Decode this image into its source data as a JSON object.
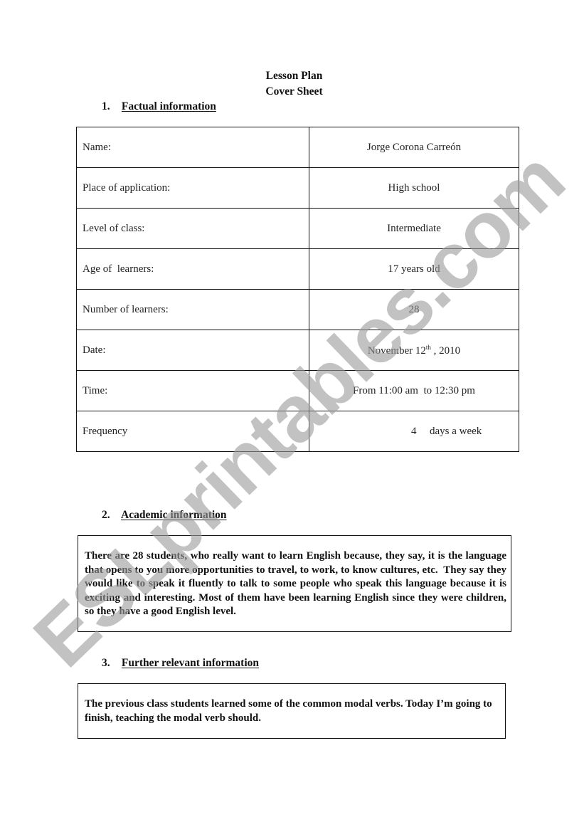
{
  "document": {
    "title_line_1": "Lesson Plan",
    "title_line_2": "Cover Sheet"
  },
  "sections": [
    {
      "number": "1.",
      "heading": "Factual information",
      "rows": [
        {
          "label": "Name:",
          "value": "Jorge Corona Carreón"
        },
        {
          "label": "Place of application:",
          "value": "High school"
        },
        {
          "label": "Level of class:",
          "value": "Intermediate"
        },
        {
          "label": "Age of  learners:",
          "value": "17 years old"
        },
        {
          "label": "Number of learners:",
          "value": "28"
        },
        {
          "label": "Date:",
          "value_prefix": "November 12",
          "value_sup": "th",
          "value_suffix": " , 2010"
        },
        {
          "label": "Time:",
          "value": "From 11:00 am  to 12:30 pm"
        },
        {
          "label": "Frequency",
          "value_number": "4",
          "value_text": "days a week"
        }
      ]
    },
    {
      "number": "2.",
      "heading": "Academic information",
      "body": "There are 28 students, who really want to learn English because, they say, it is the language that opens to you more opportunities to travel, to work, to know cultures, etc.  They say they would like to speak it fluently to talk to some people who speak this language because it is exciting and interesting. Most of them have been learning English since they were children, so they have a good English level."
    },
    {
      "number": "3.",
      "heading": "Further relevant information",
      "body": "The previous class students learned some of the common modal verbs. Today I’m going to finish, teaching the modal verb should."
    }
  ],
  "watermark": {
    "text": "ESLprintables.com",
    "color": "#9a9a9a"
  }
}
